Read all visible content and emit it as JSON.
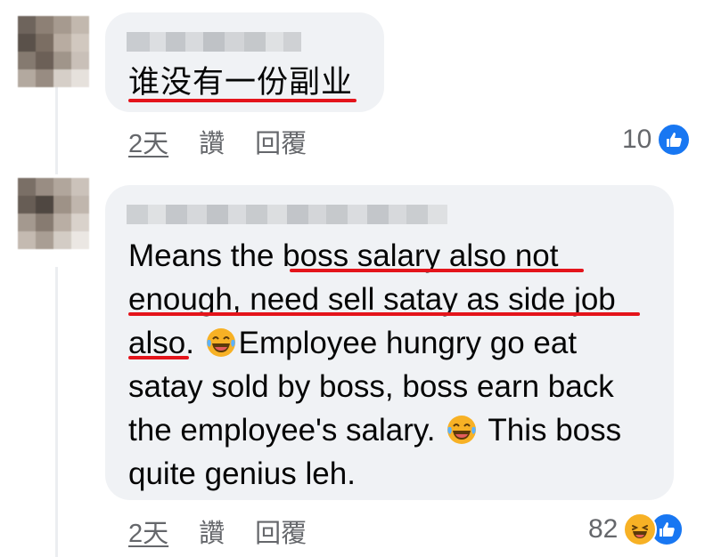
{
  "comments": [
    {
      "text_lines": [
        "谁没有一份副业"
      ],
      "actions": {
        "time": "2天",
        "like": "讚",
        "reply": "回覆"
      },
      "reactions": {
        "count": "10",
        "types": [
          "like"
        ]
      }
    },
    {
      "text_lines": [
        "Means the boss salary also not",
        "enough, need sell satay as side job",
        "also. 😂Employee hungry go eat",
        "satay sold by boss, boss earn back",
        "the employee's salary. 😂 This boss",
        "quite genius leh."
      ],
      "actions": {
        "time": "2天",
        "like": "讚",
        "reply": "回覆"
      },
      "reactions": {
        "count": "82",
        "types": [
          "haha",
          "like"
        ]
      }
    }
  ],
  "colors": {
    "bubble": "#f0f2f5",
    "secondary_text": "#65676b",
    "underline": "#e4141b",
    "like_blue": "#1877f2",
    "haha_yellow": "#f7b125"
  },
  "icons": [
    "tearing-laughing-emoji",
    "like-reaction-icon",
    "haha-reaction-icon"
  ]
}
